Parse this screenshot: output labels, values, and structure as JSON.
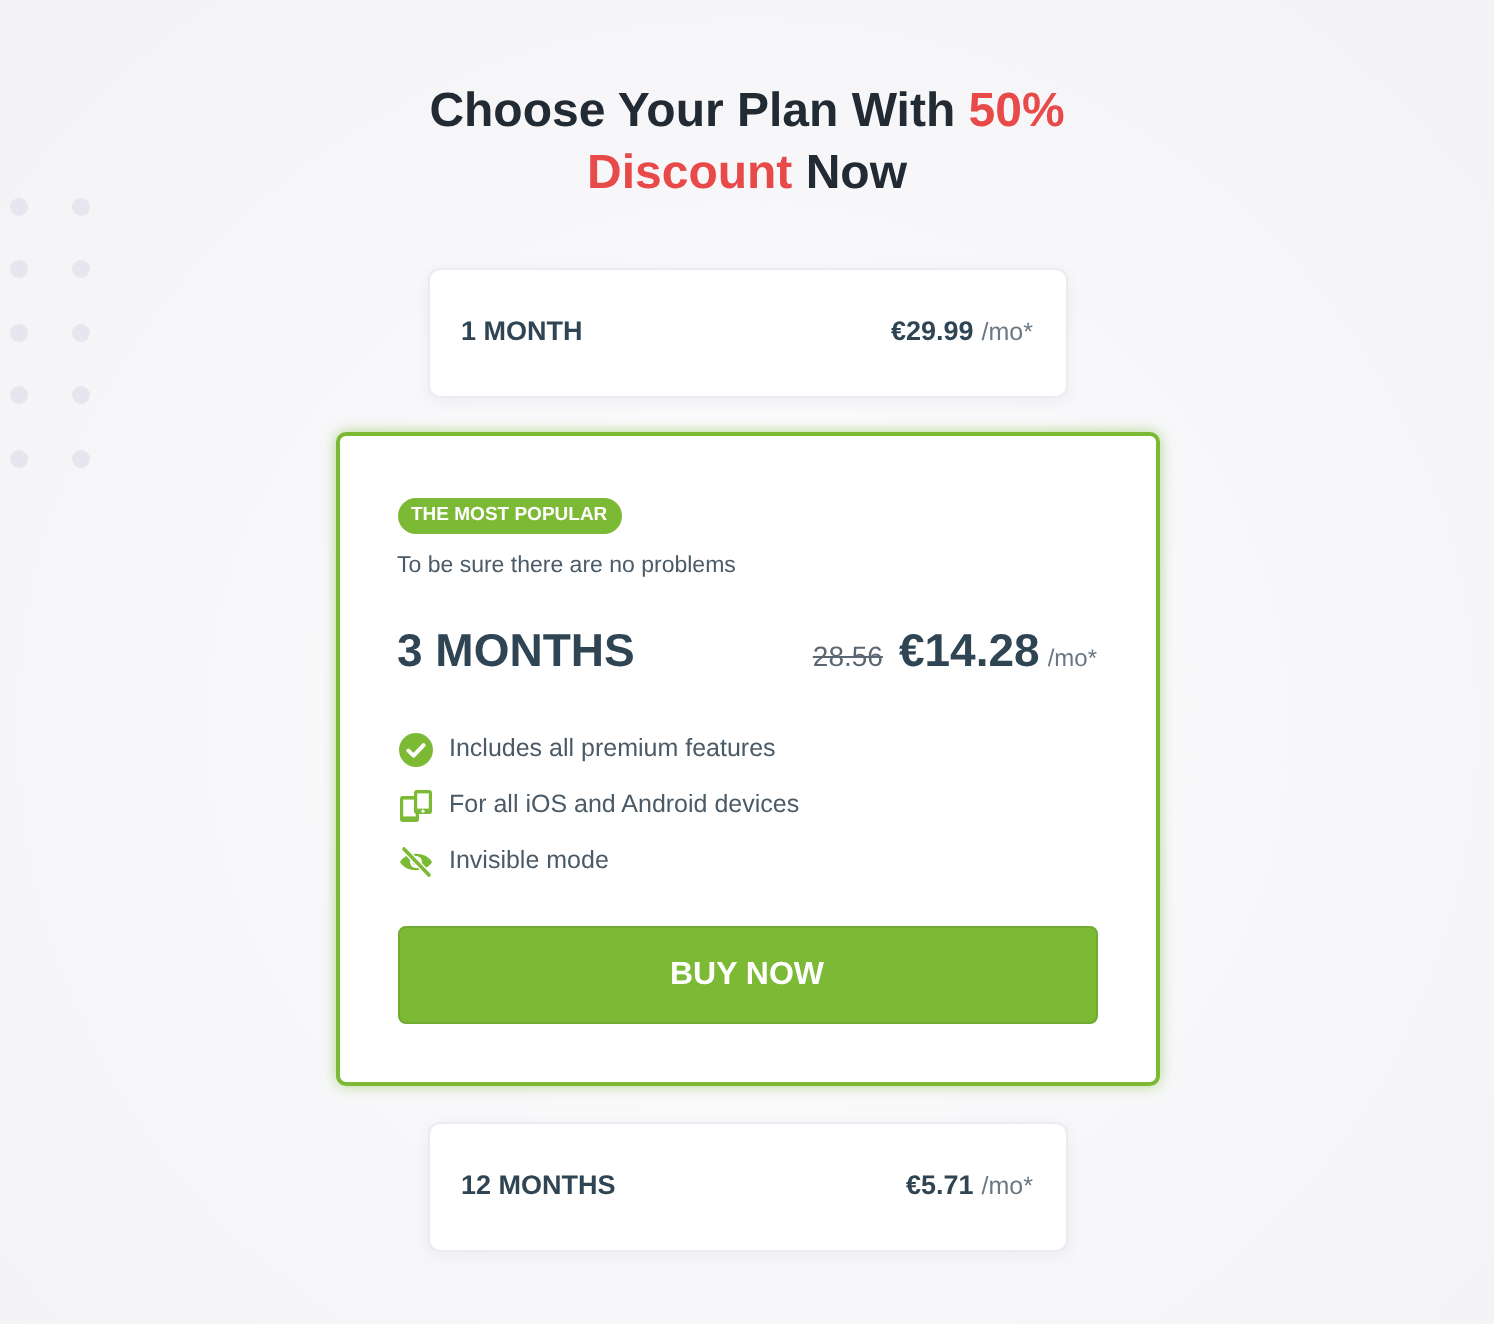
{
  "title": [
    {
      "text": "Choose Your Plan With ",
      "highlight": false
    },
    {
      "text": "50% Discount",
      "highlight": true
    },
    {
      "text": " Now",
      "highlight": false
    }
  ],
  "plans": [
    {
      "period": "1 MONTH",
      "price": "€29.99",
      "unit": "/mo*",
      "selected": false
    },
    {
      "badge": "THE MOST POPULAR",
      "subtitle": "To be sure there are no problems",
      "period": "3 MONTHS",
      "old_price": "28.56",
      "price": "€14.28",
      "unit": "/mo*",
      "features": [
        "Includes all premium features",
        "For all iOS and Android devices",
        "Invisible mode"
      ],
      "button": "BUY NOW",
      "selected": true
    },
    {
      "period": "12 MONTHS",
      "price": "€5.71",
      "unit": "/mo*",
      "selected": false
    }
  ]
}
